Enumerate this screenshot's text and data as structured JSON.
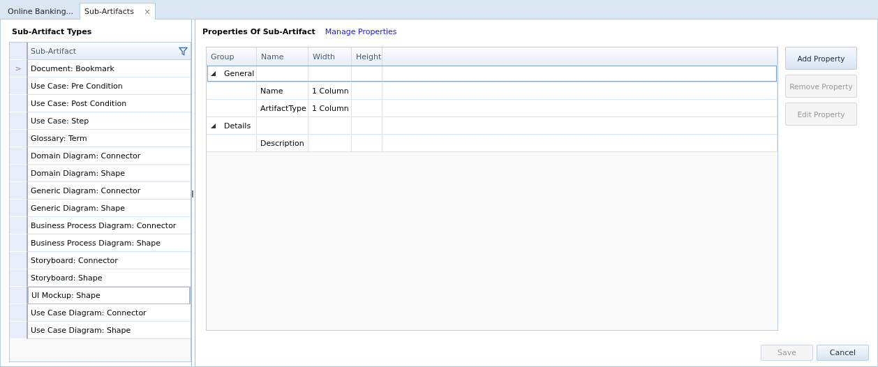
{
  "tabs": [
    {
      "label": "Online Banking...",
      "selected": false,
      "closable": false
    },
    {
      "label": "Sub-Artifacts",
      "selected": true,
      "closable": true,
      "close_glyph": "×"
    }
  ],
  "left_panel": {
    "title": "Sub-Artifact Types",
    "column": "Sub-Artifact",
    "current_glyph": ">",
    "rows": [
      {
        "label": "Document: Bookmark",
        "selected": true,
        "focused": false
      },
      {
        "label": "Use Case: Pre Condition",
        "selected": false,
        "focused": false
      },
      {
        "label": "Use Case: Post Condition",
        "selected": false,
        "focused": false
      },
      {
        "label": "Use Case: Step",
        "selected": false,
        "focused": false
      },
      {
        "label": "Glossary: Term",
        "selected": false,
        "focused": false
      },
      {
        "label": "Domain Diagram: Connector",
        "selected": false,
        "focused": false
      },
      {
        "label": "Domain Diagram: Shape",
        "selected": false,
        "focused": false
      },
      {
        "label": "Generic Diagram: Connector",
        "selected": false,
        "focused": false
      },
      {
        "label": "Generic Diagram: Shape",
        "selected": false,
        "focused": false
      },
      {
        "label": "Business Process Diagram: Connector",
        "selected": false,
        "focused": false
      },
      {
        "label": "Business Process Diagram: Shape",
        "selected": false,
        "focused": false
      },
      {
        "label": "Storyboard: Connector",
        "selected": false,
        "focused": false
      },
      {
        "label": "Storyboard: Shape",
        "selected": false,
        "focused": false
      },
      {
        "label": "UI Mockup: Shape",
        "selected": false,
        "focused": true
      },
      {
        "label": "Use Case Diagram: Connector",
        "selected": false,
        "focused": false
      },
      {
        "label": "Use Case Diagram: Shape",
        "selected": false,
        "focused": false
      }
    ]
  },
  "right_panel": {
    "title": "Properties Of Sub-Artifact",
    "link": "Manage Properties",
    "table": {
      "columns": [
        "Group",
        "Name",
        "Width",
        "Height"
      ],
      "rows": [
        {
          "kind": "group",
          "label": "General",
          "expanded": true,
          "focused": true
        },
        {
          "kind": "item",
          "name": "Name",
          "width": "1 Column",
          "focused": false
        },
        {
          "kind": "item",
          "name": "ArtifactType",
          "width": "1 Column",
          "focused": false
        },
        {
          "kind": "group",
          "label": "Details",
          "expanded": true,
          "focused": false
        },
        {
          "kind": "item",
          "name": "Description",
          "focused": false
        }
      ]
    },
    "side_buttons": [
      {
        "label": "Add Property",
        "disabled": false
      },
      {
        "label": "Remove Property",
        "disabled": true
      },
      {
        "label": "Edit Property",
        "disabled": true
      }
    ]
  },
  "footer_buttons": [
    {
      "label": "Save",
      "disabled": true
    },
    {
      "label": "Cancel",
      "disabled": false
    }
  ]
}
